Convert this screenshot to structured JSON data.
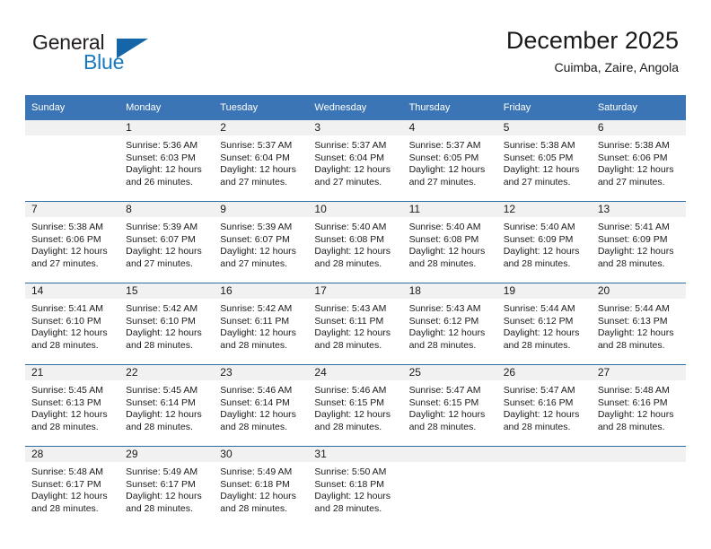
{
  "brand": {
    "name_top": "General",
    "name_bottom": "Blue",
    "triangle_color": "#1466a8",
    "blue_text_color": "#1878be"
  },
  "header": {
    "title": "December 2025",
    "subtitle": "Cuimba, Zaire, Angola"
  },
  "theme": {
    "header_row_bg": "#3b75b5",
    "header_row_text": "#ffffff",
    "daynum_bg": "#f1f1f1",
    "row_divider": "#2e6ca8",
    "cell_bg": "#ffffff",
    "text": "#1a1a1a"
  },
  "weekday_headers": [
    "Sunday",
    "Monday",
    "Tuesday",
    "Wednesday",
    "Thursday",
    "Friday",
    "Saturday"
  ],
  "labels": {
    "sunrise_prefix": "Sunrise:",
    "sunset_prefix": "Sunset:",
    "daylight_prefix": "Daylight:"
  },
  "weeks": [
    [
      {
        "day": "",
        "blank": true,
        "line1": "",
        "line2": "",
        "line3": "",
        "line4": ""
      },
      {
        "day": "1",
        "blank": false,
        "line1": "Sunrise: 5:36 AM",
        "line2": "Sunset: 6:03 PM",
        "line3": "Daylight: 12 hours",
        "line4": "and 26 minutes."
      },
      {
        "day": "2",
        "blank": false,
        "line1": "Sunrise: 5:37 AM",
        "line2": "Sunset: 6:04 PM",
        "line3": "Daylight: 12 hours",
        "line4": "and 27 minutes."
      },
      {
        "day": "3",
        "blank": false,
        "line1": "Sunrise: 5:37 AM",
        "line2": "Sunset: 6:04 PM",
        "line3": "Daylight: 12 hours",
        "line4": "and 27 minutes."
      },
      {
        "day": "4",
        "blank": false,
        "line1": "Sunrise: 5:37 AM",
        "line2": "Sunset: 6:05 PM",
        "line3": "Daylight: 12 hours",
        "line4": "and 27 minutes."
      },
      {
        "day": "5",
        "blank": false,
        "line1": "Sunrise: 5:38 AM",
        "line2": "Sunset: 6:05 PM",
        "line3": "Daylight: 12 hours",
        "line4": "and 27 minutes."
      },
      {
        "day": "6",
        "blank": false,
        "line1": "Sunrise: 5:38 AM",
        "line2": "Sunset: 6:06 PM",
        "line3": "Daylight: 12 hours",
        "line4": "and 27 minutes."
      }
    ],
    [
      {
        "day": "7",
        "blank": false,
        "line1": "Sunrise: 5:38 AM",
        "line2": "Sunset: 6:06 PM",
        "line3": "Daylight: 12 hours",
        "line4": "and 27 minutes."
      },
      {
        "day": "8",
        "blank": false,
        "line1": "Sunrise: 5:39 AM",
        "line2": "Sunset: 6:07 PM",
        "line3": "Daylight: 12 hours",
        "line4": "and 27 minutes."
      },
      {
        "day": "9",
        "blank": false,
        "line1": "Sunrise: 5:39 AM",
        "line2": "Sunset: 6:07 PM",
        "line3": "Daylight: 12 hours",
        "line4": "and 27 minutes."
      },
      {
        "day": "10",
        "blank": false,
        "line1": "Sunrise: 5:40 AM",
        "line2": "Sunset: 6:08 PM",
        "line3": "Daylight: 12 hours",
        "line4": "and 28 minutes."
      },
      {
        "day": "11",
        "blank": false,
        "line1": "Sunrise: 5:40 AM",
        "line2": "Sunset: 6:08 PM",
        "line3": "Daylight: 12 hours",
        "line4": "and 28 minutes."
      },
      {
        "day": "12",
        "blank": false,
        "line1": "Sunrise: 5:40 AM",
        "line2": "Sunset: 6:09 PM",
        "line3": "Daylight: 12 hours",
        "line4": "and 28 minutes."
      },
      {
        "day": "13",
        "blank": false,
        "line1": "Sunrise: 5:41 AM",
        "line2": "Sunset: 6:09 PM",
        "line3": "Daylight: 12 hours",
        "line4": "and 28 minutes."
      }
    ],
    [
      {
        "day": "14",
        "blank": false,
        "line1": "Sunrise: 5:41 AM",
        "line2": "Sunset: 6:10 PM",
        "line3": "Daylight: 12 hours",
        "line4": "and 28 minutes."
      },
      {
        "day": "15",
        "blank": false,
        "line1": "Sunrise: 5:42 AM",
        "line2": "Sunset: 6:10 PM",
        "line3": "Daylight: 12 hours",
        "line4": "and 28 minutes."
      },
      {
        "day": "16",
        "blank": false,
        "line1": "Sunrise: 5:42 AM",
        "line2": "Sunset: 6:11 PM",
        "line3": "Daylight: 12 hours",
        "line4": "and 28 minutes."
      },
      {
        "day": "17",
        "blank": false,
        "line1": "Sunrise: 5:43 AM",
        "line2": "Sunset: 6:11 PM",
        "line3": "Daylight: 12 hours",
        "line4": "and 28 minutes."
      },
      {
        "day": "18",
        "blank": false,
        "line1": "Sunrise: 5:43 AM",
        "line2": "Sunset: 6:12 PM",
        "line3": "Daylight: 12 hours",
        "line4": "and 28 minutes."
      },
      {
        "day": "19",
        "blank": false,
        "line1": "Sunrise: 5:44 AM",
        "line2": "Sunset: 6:12 PM",
        "line3": "Daylight: 12 hours",
        "line4": "and 28 minutes."
      },
      {
        "day": "20",
        "blank": false,
        "line1": "Sunrise: 5:44 AM",
        "line2": "Sunset: 6:13 PM",
        "line3": "Daylight: 12 hours",
        "line4": "and 28 minutes."
      }
    ],
    [
      {
        "day": "21",
        "blank": false,
        "line1": "Sunrise: 5:45 AM",
        "line2": "Sunset: 6:13 PM",
        "line3": "Daylight: 12 hours",
        "line4": "and 28 minutes."
      },
      {
        "day": "22",
        "blank": false,
        "line1": "Sunrise: 5:45 AM",
        "line2": "Sunset: 6:14 PM",
        "line3": "Daylight: 12 hours",
        "line4": "and 28 minutes."
      },
      {
        "day": "23",
        "blank": false,
        "line1": "Sunrise: 5:46 AM",
        "line2": "Sunset: 6:14 PM",
        "line3": "Daylight: 12 hours",
        "line4": "and 28 minutes."
      },
      {
        "day": "24",
        "blank": false,
        "line1": "Sunrise: 5:46 AM",
        "line2": "Sunset: 6:15 PM",
        "line3": "Daylight: 12 hours",
        "line4": "and 28 minutes."
      },
      {
        "day": "25",
        "blank": false,
        "line1": "Sunrise: 5:47 AM",
        "line2": "Sunset: 6:15 PM",
        "line3": "Daylight: 12 hours",
        "line4": "and 28 minutes."
      },
      {
        "day": "26",
        "blank": false,
        "line1": "Sunrise: 5:47 AM",
        "line2": "Sunset: 6:16 PM",
        "line3": "Daylight: 12 hours",
        "line4": "and 28 minutes."
      },
      {
        "day": "27",
        "blank": false,
        "line1": "Sunrise: 5:48 AM",
        "line2": "Sunset: 6:16 PM",
        "line3": "Daylight: 12 hours",
        "line4": "and 28 minutes."
      }
    ],
    [
      {
        "day": "28",
        "blank": false,
        "line1": "Sunrise: 5:48 AM",
        "line2": "Sunset: 6:17 PM",
        "line3": "Daylight: 12 hours",
        "line4": "and 28 minutes."
      },
      {
        "day": "29",
        "blank": false,
        "line1": "Sunrise: 5:49 AM",
        "line2": "Sunset: 6:17 PM",
        "line3": "Daylight: 12 hours",
        "line4": "and 28 minutes."
      },
      {
        "day": "30",
        "blank": false,
        "line1": "Sunrise: 5:49 AM",
        "line2": "Sunset: 6:18 PM",
        "line3": "Daylight: 12 hours",
        "line4": "and 28 minutes."
      },
      {
        "day": "31",
        "blank": false,
        "line1": "Sunrise: 5:50 AM",
        "line2": "Sunset: 6:18 PM",
        "line3": "Daylight: 12 hours",
        "line4": "and 28 minutes."
      },
      {
        "day": "",
        "blank": true,
        "line1": "",
        "line2": "",
        "line3": "",
        "line4": ""
      },
      {
        "day": "",
        "blank": true,
        "line1": "",
        "line2": "",
        "line3": "",
        "line4": ""
      },
      {
        "day": "",
        "blank": true,
        "line1": "",
        "line2": "",
        "line3": "",
        "line4": ""
      }
    ]
  ]
}
